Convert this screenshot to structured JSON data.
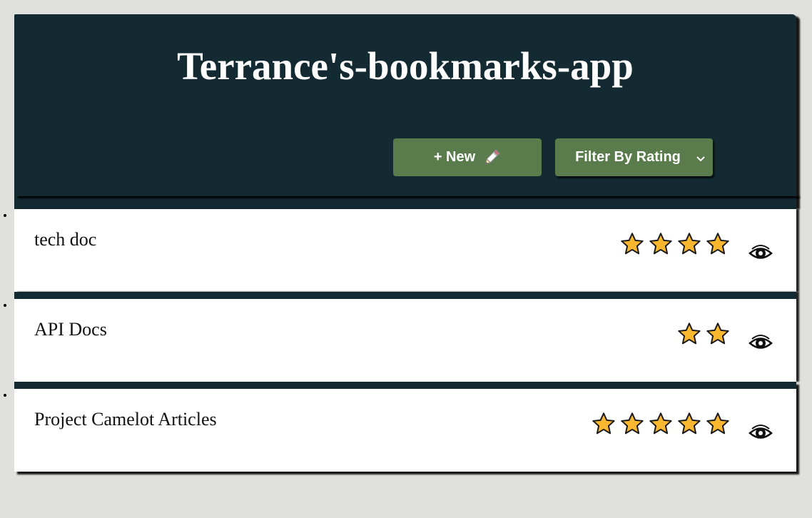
{
  "app": {
    "title": "Terrance's-bookmarks-app"
  },
  "toolbar": {
    "new_label": "+ New",
    "new_icon": "pencil-icon",
    "filter_label": "Filter By Rating",
    "filter_icon": "chevron-down-icon"
  },
  "colors": {
    "header_bg": "#132a33",
    "button_bg": "#5a7b4b",
    "page_bg": "#e0e1dd",
    "star_fill": "#f9b62f"
  },
  "bookmarks": [
    {
      "title": "tech doc",
      "rating": 4
    },
    {
      "title": "API Docs",
      "rating": 2
    },
    {
      "title": "Project Camelot Articles",
      "rating": 5
    }
  ]
}
